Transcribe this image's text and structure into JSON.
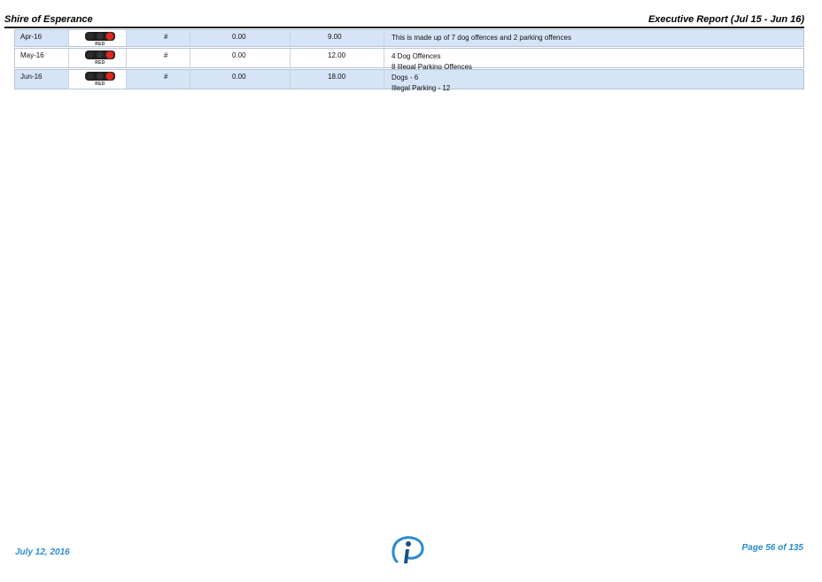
{
  "header": {
    "org": "Shire of Esperance",
    "report": "Executive Report (Jul 15 - Jun 16)"
  },
  "rows": [
    {
      "month": "Apr-16",
      "status": "RED",
      "unit": "#",
      "target": "0.00",
      "actual": "9.00",
      "comments": [
        "This is made up of 7 dog offences and 2 parking offences"
      ]
    },
    {
      "month": "May-16",
      "status": "RED",
      "unit": "#",
      "target": "0.00",
      "actual": "12.00",
      "comments": [
        "4 Dog Offences",
        "8 Illegal Parking Offences"
      ]
    },
    {
      "month": "Jun-16",
      "status": "RED",
      "unit": "#",
      "target": "0.00",
      "actual": "18.00",
      "comments": [
        "Dogs - 6",
        "Illegal Parking - 12"
      ]
    }
  ],
  "footer": {
    "date": "July 12, 2016",
    "page": "Page 56 of 135"
  },
  "colors": {
    "accent": "#2a8bd0",
    "row_shade": "#d5e4f7",
    "status_red": "#e0261e"
  },
  "icons": {
    "status_light": "traffic-light-icon",
    "logo": "info-logo-icon"
  }
}
